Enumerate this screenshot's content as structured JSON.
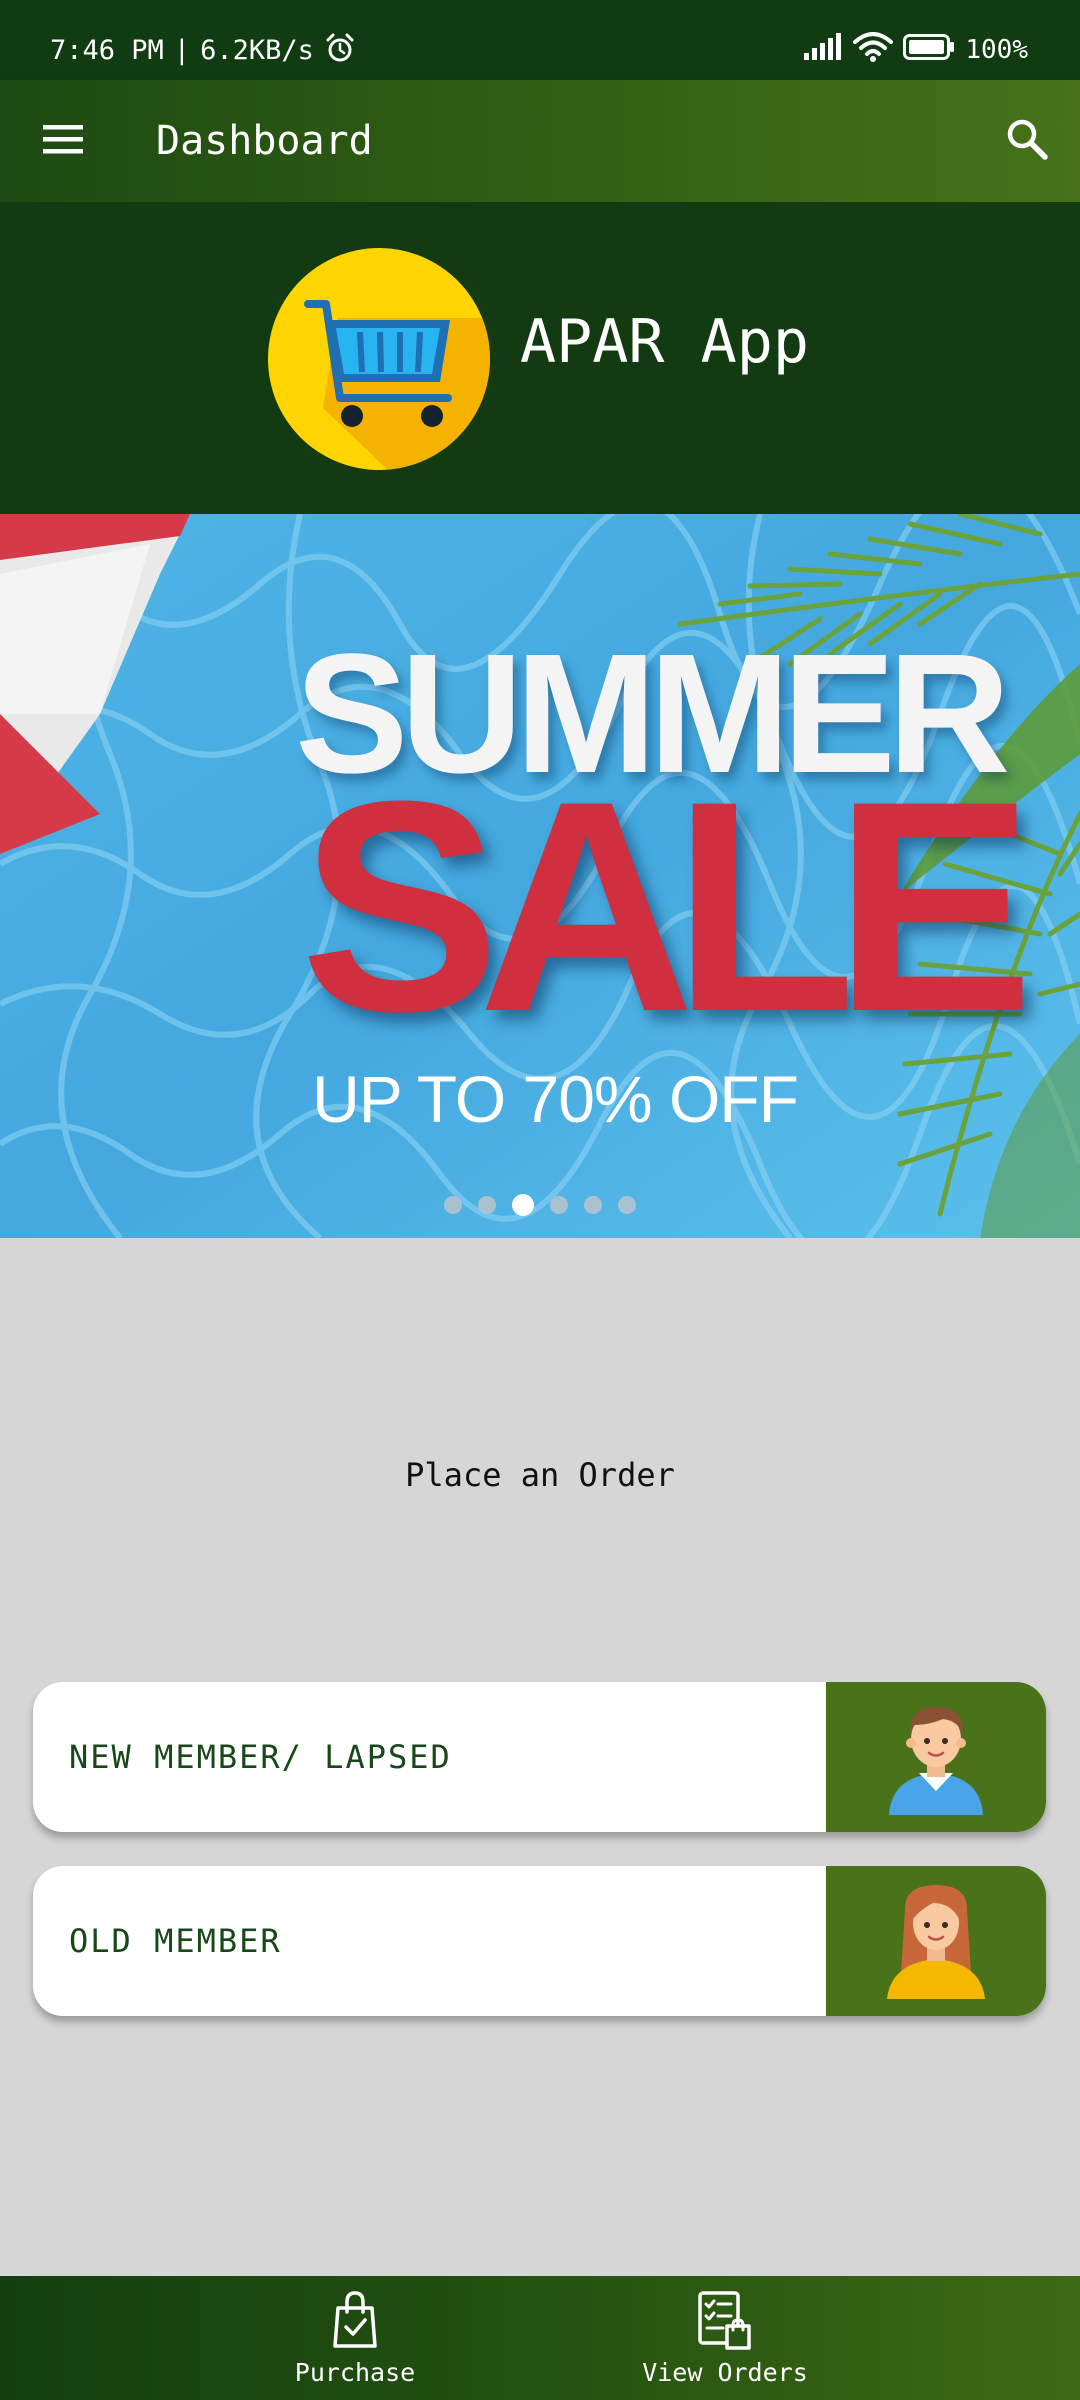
{
  "status_bar": {
    "time": "7:46 PM",
    "separator": "|",
    "network_speed": "6.2KB/s",
    "battery": "100%",
    "icons": [
      "alarm-icon",
      "signal-icon",
      "wifi-icon",
      "battery-icon"
    ]
  },
  "app_bar": {
    "title": "Dashboard",
    "icons": [
      "menu-icon",
      "search-icon"
    ]
  },
  "brand": {
    "name": "APAR App",
    "logo_icon": "shopping-cart-icon"
  },
  "banner": {
    "line1": "SUMMER",
    "line2": "SALE",
    "line3": "UP TO 70% OFF",
    "slide_count": 6,
    "active_slide": 3
  },
  "main": {
    "prompt": "Place an Order",
    "options": [
      {
        "label": "NEW MEMBER/ LAPSED",
        "icon": "male-avatar-icon"
      },
      {
        "label": "OLD MEMBER",
        "icon": "female-avatar-icon"
      }
    ]
  },
  "bottom_nav": {
    "items": [
      {
        "label": "Purchase",
        "icon": "shopping-bag-check-icon"
      },
      {
        "label": "View Orders",
        "icon": "orders-list-icon"
      }
    ]
  },
  "colors": {
    "status_bar": "#113b10",
    "brand_header": "#123b11",
    "accent_green": "#4a7218",
    "page_background": "#d6d6d6",
    "sale_red": "#cf2f3e",
    "banner_water": "#4db0e4"
  }
}
